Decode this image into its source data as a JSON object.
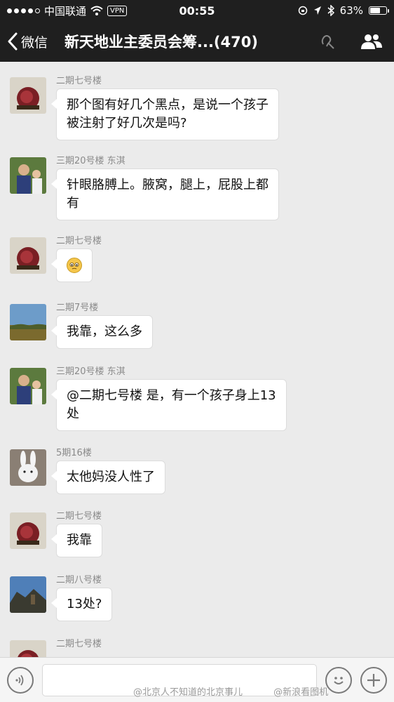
{
  "status_bar": {
    "carrier": "中国联通",
    "vpn": "VPN",
    "time": "00:55",
    "battery": "63%",
    "battery_level": 0.63
  },
  "nav": {
    "back_label": "微信",
    "title": "新天地业主委员会筹...(470)"
  },
  "messages": [
    {
      "sender": "二期七号楼",
      "lines": [
        "那个图有好几个黑点，是说一个孩子",
        "被注射了好几次是吗?"
      ],
      "avatar": "flower"
    },
    {
      "sender": "三期20号楼 东淇",
      "lines": [
        "针眼胳膊上。腋窝，腿上，屁股上都",
        "有"
      ],
      "avatar": "family"
    },
    {
      "sender": "二期七号楼",
      "lines": [],
      "emoji": "worried-face-emoji",
      "avatar": "flower"
    },
    {
      "sender": "二期7号楼",
      "lines": [
        "我靠，这么多"
      ],
      "avatar": "landscape"
    },
    {
      "sender": "三期20号楼 东淇",
      "lines": [
        "@二期七号楼 是，有一个孩子身上13",
        "处"
      ],
      "avatar": "family"
    },
    {
      "sender": "5期16楼",
      "lines": [
        "太他妈没人性了"
      ],
      "avatar": "rabbit"
    },
    {
      "sender": "二期七号楼",
      "lines": [
        "我靠"
      ],
      "avatar": "flower"
    },
    {
      "sender": "二期八号楼",
      "lines": [
        "13处?"
      ],
      "avatar": "sky"
    },
    {
      "sender": "二期七号楼",
      "lines": [],
      "avatar": "flower"
    }
  ],
  "input_bar": {
    "voice_icon": "voice-icon",
    "emoji_icon": "emoji-icon",
    "plus_icon": "plus-icon",
    "placeholder": ""
  },
  "watermark": "@北京人不知道的北京事儿",
  "watermark_right": "@新浪看图机"
}
